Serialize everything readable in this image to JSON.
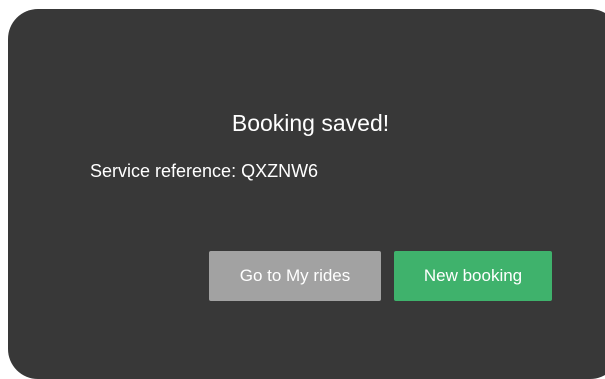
{
  "dialog": {
    "title": "Booking saved!",
    "reference_text": "Service reference: QXZNW6",
    "buttons": {
      "my_rides_label": "Go to My rides",
      "new_booking_label": "New booking"
    }
  },
  "colors": {
    "dialog_background": "#383838",
    "secondary_button": "#a2a2a2",
    "primary_button": "#3fb26c",
    "text": "#ffffff"
  }
}
